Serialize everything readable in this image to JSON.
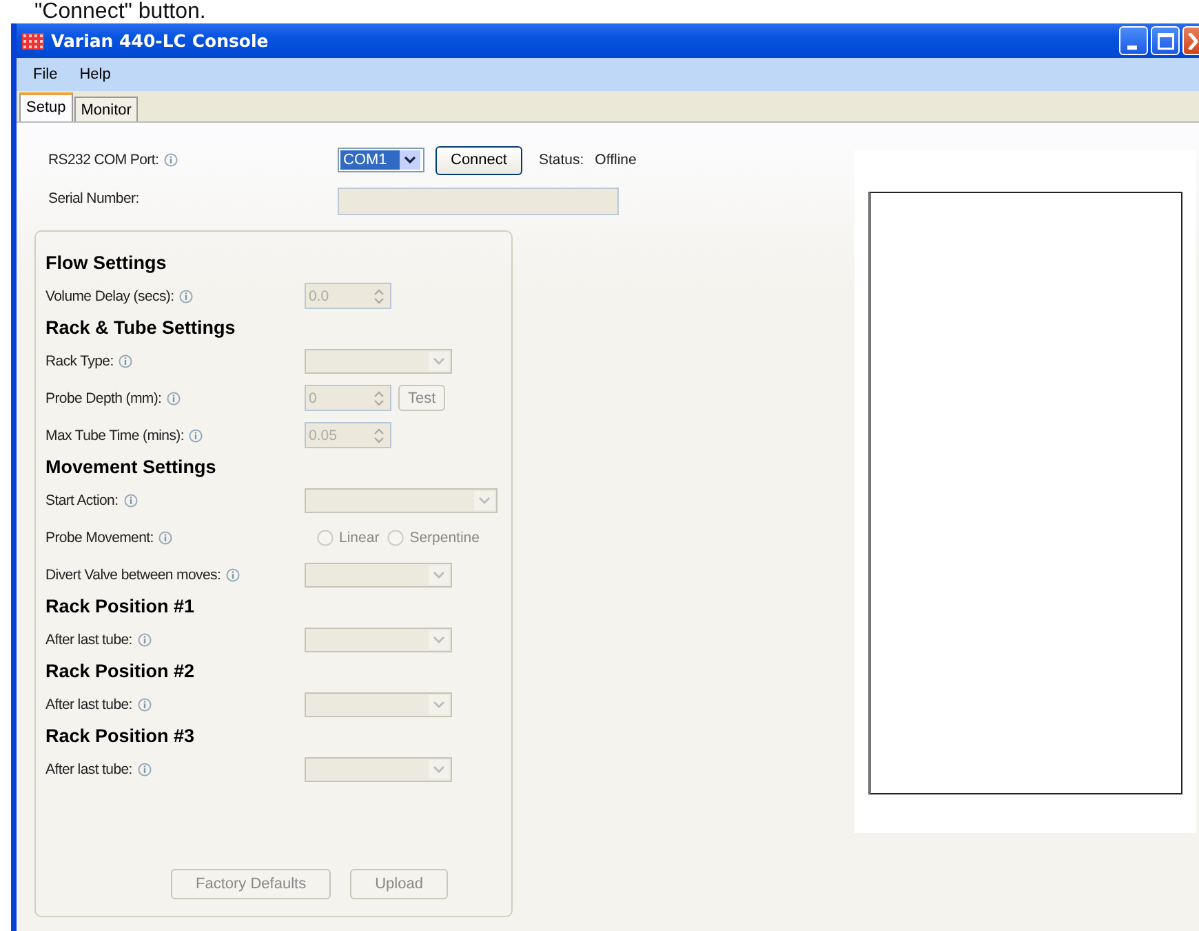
{
  "caption": "\"Connect\" button.",
  "window": {
    "title": "Varian 440-LC Console"
  },
  "menu": [
    "File",
    "Help"
  ],
  "tabs": [
    {
      "label": "Setup",
      "selected": true
    },
    {
      "label": "Monitor",
      "selected": false
    }
  ],
  "connection": {
    "port_label": "RS232 COM Port:",
    "port_value": "COM1",
    "connect_button": "Connect",
    "status_label": "Status:",
    "status_value": "Offline",
    "serial_label": "Serial Number:"
  },
  "sections": [
    {
      "heading": "Flow Settings",
      "rows": [
        {
          "label": "Volume Delay (secs):",
          "kind": "spin",
          "value": "0.0",
          "disabled": true
        }
      ]
    },
    {
      "heading": "Rack & Tube Settings",
      "rows": [
        {
          "label": "Rack Type:",
          "kind": "dropdown",
          "disabled": true
        },
        {
          "label": "Probe Depth (mm):",
          "kind": "spin",
          "value": "0",
          "disabled": true,
          "button": "Test"
        },
        {
          "label": "Max Tube Time (mins):",
          "kind": "spin",
          "value": "0.05",
          "disabled": true
        }
      ]
    },
    {
      "heading": "Movement Settings",
      "rows": [
        {
          "label": "Start Action:",
          "kind": "wide-dropdown",
          "disabled": true
        },
        {
          "label": "Probe Movement:",
          "kind": "radio",
          "disabled": true,
          "options": [
            {
              "label": "Linear",
              "selected": false
            },
            {
              "label": "Serpentine",
              "selected": false
            }
          ]
        },
        {
          "label": "Divert Valve between moves:",
          "kind": "dropdown",
          "disabled": true
        }
      ]
    },
    {
      "heading": "Rack Position #1",
      "rows": [
        {
          "label": "After last tube:",
          "kind": "dropdown",
          "disabled": true
        }
      ]
    },
    {
      "heading": "Rack Position #2",
      "rows": [
        {
          "label": "After last tube:",
          "kind": "dropdown",
          "disabled": true
        }
      ]
    },
    {
      "heading": "Rack Position #3",
      "rows": [
        {
          "label": "After last tube:",
          "kind": "dropdown",
          "disabled": true
        }
      ]
    }
  ],
  "bottom_buttons": [
    {
      "label": "Factory Defaults",
      "disabled": true
    },
    {
      "label": "Upload",
      "disabled": true
    }
  ]
}
